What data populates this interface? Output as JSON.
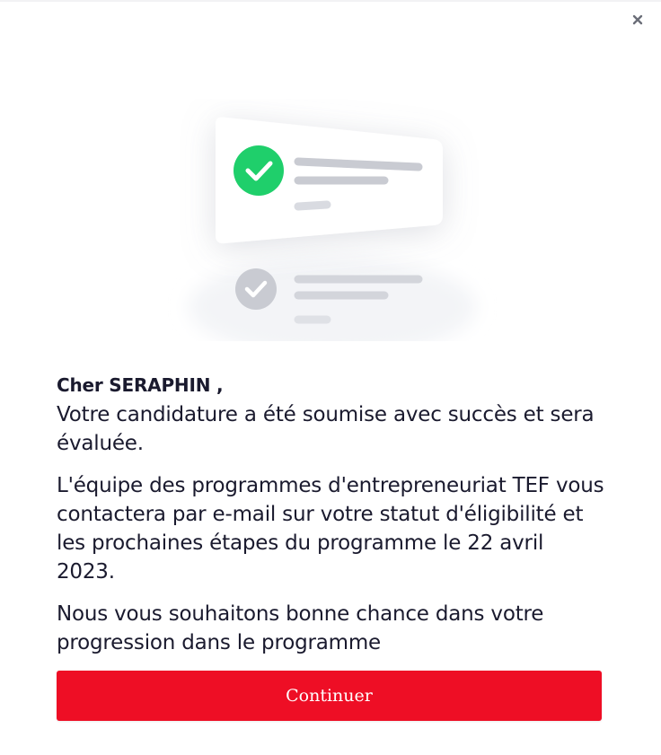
{
  "dialog": {
    "close_icon": "close-icon",
    "greeting": "Cher SERAPHIN ,",
    "message_submitted": "Votre candidature a été soumise avec succès et sera évaluée.",
    "message_contact": "L'équipe des programmes d'entrepreneuriat TEF vous contactera par e-mail sur votre statut d'éligibilité et les prochaines étapes du programme le 22 avril 2023.",
    "message_wish": "Nous vous souhaitons bonne chance dans votre progression dans le programme",
    "continue_label": "Continuer"
  },
  "illustration": {
    "first_check_icon": "check-circle-icon",
    "second_check_icon": "check-circle-icon"
  },
  "colors": {
    "accent": "#ee0e25",
    "success_green": "#1fcf6b",
    "muted_grey": "#c9cbd2",
    "text": "#1a1a2e"
  }
}
